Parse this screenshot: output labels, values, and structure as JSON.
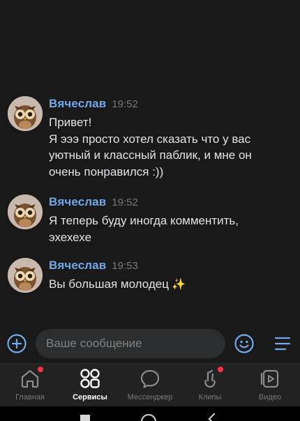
{
  "messages": [
    {
      "author": "Вячеслав",
      "time": "19:52",
      "lines": [
        "Привет!",
        "Я эээ просто хотел сказать что у вас",
        "уютный и классный паблик, и мне он",
        "очень понравился :))"
      ]
    },
    {
      "author": "Вячеслав",
      "time": "19:52",
      "lines": [
        "Я теперь буду иногда комментить,",
        "эхехехе"
      ]
    },
    {
      "author": "Вячеслав",
      "time": "19:53",
      "lines": [
        "Вы большая молодец"
      ],
      "emoji": "✨"
    }
  ],
  "composer": {
    "placeholder": "Ваше сообщение"
  },
  "tabs": [
    {
      "label": "Главная",
      "icon": "home-icon",
      "badge": true
    },
    {
      "label": "Сервисы",
      "icon": "services-icon",
      "active": true
    },
    {
      "label": "Мессенджер",
      "icon": "messenger-icon"
    },
    {
      "label": "Клипы",
      "icon": "clips-icon",
      "badge": true
    },
    {
      "label": "Видео",
      "icon": "video-icon"
    }
  ],
  "colors": {
    "accent": "#71aaeb",
    "badge": "#ff3347",
    "background": "#19191a"
  }
}
